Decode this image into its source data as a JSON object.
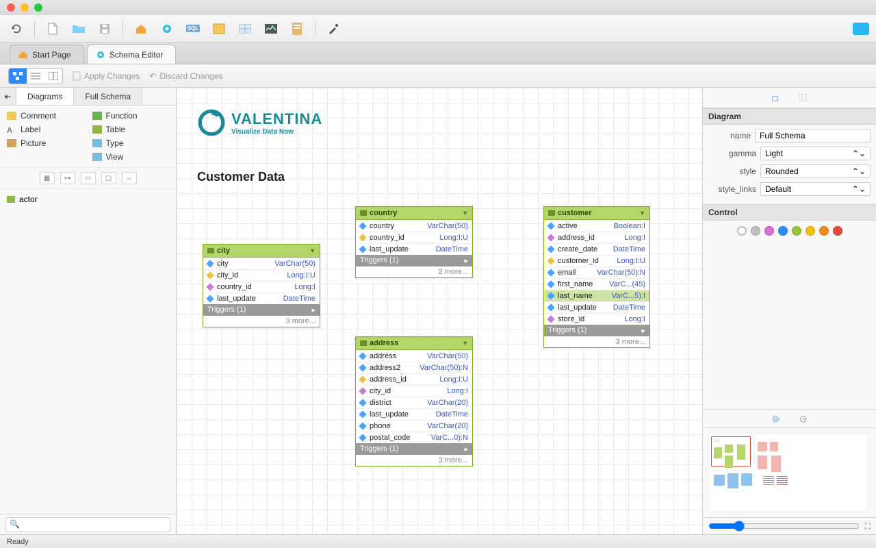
{
  "tabs": {
    "start": "Start Page",
    "schema": "Schema Editor"
  },
  "subtoolbar": {
    "apply": "Apply Changes",
    "discard": "Discard Changes"
  },
  "sidebar": {
    "tab_diagrams": "Diagrams",
    "tab_fullschema": "Full Schema",
    "palette": {
      "comment": "Comment",
      "function": "Function",
      "label": "Label",
      "table": "Table",
      "picture": "Picture",
      "type": "Type",
      "view": "View"
    },
    "tree_item": "actor",
    "search_placeholder": ""
  },
  "canvas": {
    "brand": "VALENTINA",
    "brand_sub": "Visualize Data Now",
    "title": "Customer Data",
    "city": {
      "title": "city",
      "triggers": "Triggers (1)",
      "more": "3 more...",
      "rows": [
        {
          "n": "city",
          "t": "VarChar(50)",
          "k": "f"
        },
        {
          "n": "city_id",
          "t": "Long:I:U",
          "k": "k"
        },
        {
          "n": "country_id",
          "t": "Long:I",
          "k": "fk"
        },
        {
          "n": "last_update",
          "t": "DateTime",
          "k": "f"
        }
      ]
    },
    "country": {
      "title": "country",
      "triggers": "Triggers (1)",
      "more": "2 more...",
      "rows": [
        {
          "n": "country",
          "t": "VarChar(50)",
          "k": "f"
        },
        {
          "n": "country_id",
          "t": "Long:I:U",
          "k": "k"
        },
        {
          "n": "last_update",
          "t": "DateTime",
          "k": "f"
        }
      ]
    },
    "address": {
      "title": "address",
      "triggers": "Triggers (1)",
      "more": "3 more...",
      "rows": [
        {
          "n": "address",
          "t": "VarChar(50)",
          "k": "f"
        },
        {
          "n": "address2",
          "t": "VarChar(50):N",
          "k": "f"
        },
        {
          "n": "address_id",
          "t": "Long:I:U",
          "k": "k"
        },
        {
          "n": "city_id",
          "t": "Long:I",
          "k": "fk"
        },
        {
          "n": "district",
          "t": "VarChar(20)",
          "k": "f"
        },
        {
          "n": "last_update",
          "t": "DateTime",
          "k": "f"
        },
        {
          "n": "phone",
          "t": "VarChar(20)",
          "k": "f"
        },
        {
          "n": "postal_code",
          "t": "VarC...0):N",
          "k": "f"
        }
      ]
    },
    "customer": {
      "title": "customer",
      "triggers": "Triggers (1)",
      "more": "3 more...",
      "rows": [
        {
          "n": "active",
          "t": "Boolean:I",
          "k": "f"
        },
        {
          "n": "address_id",
          "t": "Long:I",
          "k": "fk"
        },
        {
          "n": "create_date",
          "t": "DateTime",
          "k": "f"
        },
        {
          "n": "customer_id",
          "t": "Long:I:U",
          "k": "k"
        },
        {
          "n": "email",
          "t": "VarChar(50):N",
          "k": "f"
        },
        {
          "n": "first_name",
          "t": "VarC...(45)",
          "k": "f"
        },
        {
          "n": "last_name",
          "t": "VarC...5):I",
          "k": "f",
          "sel": true
        },
        {
          "n": "last_update",
          "t": "DateTime",
          "k": "f"
        },
        {
          "n": "store_id",
          "t": "Long:I",
          "k": "fk"
        }
      ]
    }
  },
  "inspector": {
    "diagram_h": "Diagram",
    "control_h": "Control",
    "labels": {
      "name": "name",
      "gamma": "gamma",
      "style": "style",
      "style_links": "style_links"
    },
    "name_value": "Full Schema",
    "gamma": "Light",
    "style": "Rounded",
    "style_links": "Default",
    "colors": [
      "#d0d0d0",
      "#bfbfbf",
      "#d96fd0",
      "#2a8cff",
      "#9ac53a",
      "#f2c200",
      "#f28b1e",
      "#e84c3d"
    ]
  },
  "status": "Ready"
}
